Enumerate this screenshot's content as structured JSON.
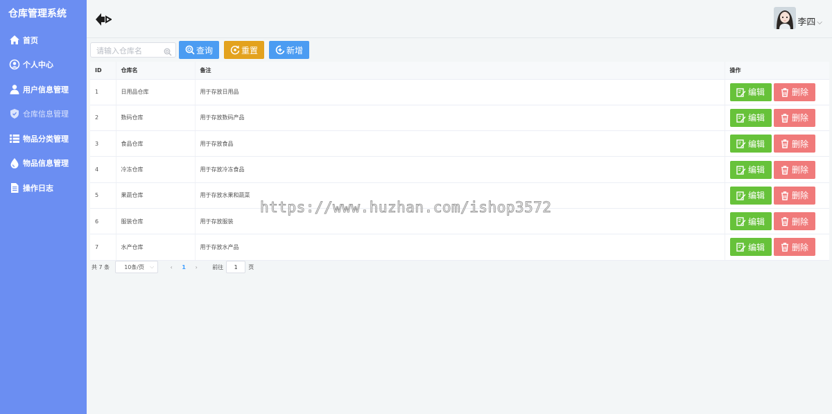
{
  "sidebar": {
    "app_title": "仓库管理系统",
    "items": [
      {
        "label": "首页",
        "icon": "home-icon"
      },
      {
        "label": "个人中心",
        "icon": "user-circle-icon"
      },
      {
        "label": "用户信息管理",
        "icon": "user-icon"
      },
      {
        "label": "仓库信息管理",
        "icon": "shield-icon",
        "active": true
      },
      {
        "label": "物品分类管理",
        "icon": "list-icon"
      },
      {
        "label": "物品信息管理",
        "icon": "drop-icon"
      },
      {
        "label": "操作日志",
        "icon": "document-icon"
      }
    ]
  },
  "header": {
    "user_name": "李四"
  },
  "toolbar": {
    "search_placeholder": "请输入仓库名",
    "query_label": "查询",
    "reset_label": "重置",
    "add_label": "新增"
  },
  "table": {
    "headers": {
      "id": "ID",
      "name": "仓库名",
      "remark": "备注",
      "action": "操作"
    },
    "edit_label": "编辑",
    "delete_label": "删除",
    "rows": [
      {
        "id": "1",
        "name": "日用品仓库",
        "remark": "用于存放日用品"
      },
      {
        "id": "2",
        "name": "数码仓库",
        "remark": "用于存放数码产品"
      },
      {
        "id": "3",
        "name": "食品仓库",
        "remark": "用于存放食品"
      },
      {
        "id": "4",
        "name": "冷冻仓库",
        "remark": "用于存放冷冻食品"
      },
      {
        "id": "5",
        "name": "果蔬仓库",
        "remark": "用于存放水果和蔬菜"
      },
      {
        "id": "6",
        "name": "服装仓库",
        "remark": "用于存放服装"
      },
      {
        "id": "7",
        "name": "水产仓库",
        "remark": "用于存放水产品"
      }
    ]
  },
  "pagination": {
    "total_text": "共 7 条",
    "page_size": "10条/页",
    "current_page": "1",
    "goto_label": "前往",
    "goto_value": "1",
    "page_suffix": "页"
  },
  "watermark": "https://www.huzhan.com/ishop3572",
  "colors": {
    "sidebar": "#6b8ef2",
    "primary": "#4b9cf2",
    "warning": "#e3a21e",
    "success": "#67c23a",
    "danger": "#f07a7a"
  }
}
